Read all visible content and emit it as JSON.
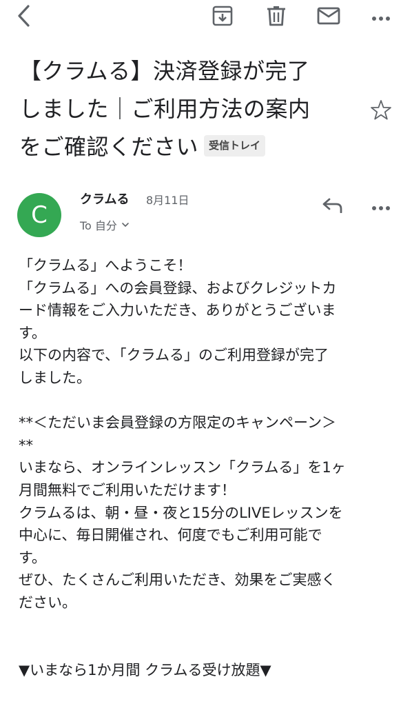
{
  "toolbar": {
    "back_icon": "chevron-left-icon",
    "archive_icon": "archive-icon",
    "delete_icon": "trash-icon",
    "mark_unread_icon": "mail-icon",
    "more_icon": "more-horizontal-icon"
  },
  "email": {
    "subject_lines": [
      "【クラムる】決済登録が完了",
      "しました｜ご利用方法の案内",
      "をご確認ください"
    ],
    "label_badge": "受信トレイ",
    "starred": false
  },
  "sender": {
    "avatar_letter": "C",
    "avatar_color": "#34a853",
    "name": "クラムる",
    "date": "8月11日",
    "recipient": "To 自分"
  },
  "body_lines": [
    "「クラムる」へようこそ！",
    "「クラムる」への会員登録、およびクレジットカ",
    "ード情報をご入力いただき、ありがとうございま",
    "す。",
    "以下の内容で、「クラムる」のご利用登録が完了",
    "しました。",
    "",
    "**＜ただいま会員登録の方限定のキャンペーン＞",
    "**",
    "いまなら、オンラインレッスン「クラムる」を1ヶ",
    "月間無料でご利用いただけます！",
    "クラムるは、朝・昼・夜と15分のLIVEレッスンを",
    "中心に、毎日開催され、何度でもご利用可能で",
    "す。",
    "ぜひ、たくさんご利用いただき、効果をご実感く",
    "ださい。",
    "",
    "",
    "▼いまなら1か月間 クラムる受け放題▼"
  ]
}
